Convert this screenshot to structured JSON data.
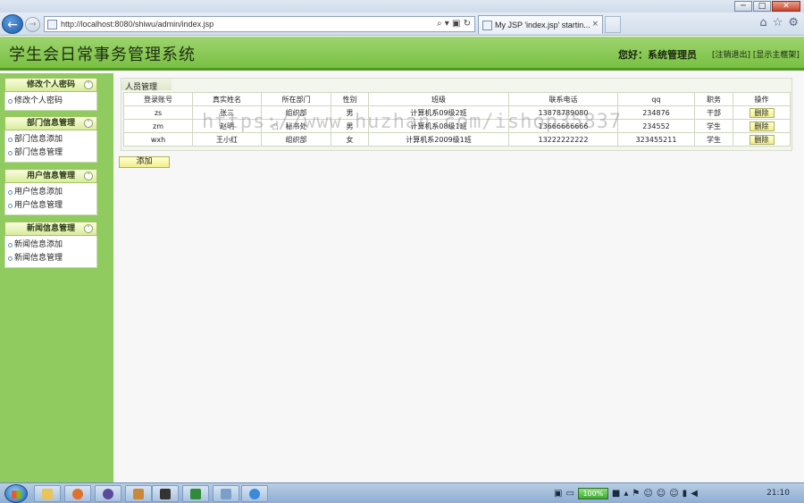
{
  "browser": {
    "window_buttons": {
      "minimize": "─",
      "maximize": "□",
      "close": "✕"
    },
    "address": "http://localhost:8080/shiwu/admin/index.jsp",
    "address_tools": "⌕ ▾ ▣ ↻",
    "tab_title": "My JSP 'index.jsp' startin...",
    "tab_close": "×",
    "nav_icons": [
      "home-icon",
      "star-icon",
      "gear-icon"
    ]
  },
  "header": {
    "title": "学生会日常事务管理系统",
    "greeting": "您好：系统管理员",
    "logout": "[注销退出]",
    "show_home": "[显示主框架]"
  },
  "sidebar": {
    "groups": [
      {
        "title": "修改个人密码",
        "items": [
          "修改个人密码"
        ]
      },
      {
        "title": "部门信息管理",
        "items": [
          "部门信息添加",
          "部门信息管理"
        ]
      },
      {
        "title": "用户信息管理",
        "items": [
          "用户信息添加",
          "用户信息管理"
        ]
      },
      {
        "title": "新闻信息管理",
        "items": [
          "新闻信息添加",
          "新闻信息管理"
        ]
      }
    ]
  },
  "main": {
    "panel_title": "人员管理",
    "columns": [
      "登录账号",
      "真实姓名",
      "所在部门",
      "性别",
      "班级",
      "联系电话",
      "qq",
      "职务",
      "操作"
    ],
    "rows": [
      [
        "zs",
        "张三",
        "组织部",
        "男",
        "计算机系09级2班",
        "13878789080",
        "234876",
        "干部"
      ],
      [
        "zm",
        "赵明",
        "秘书处",
        "男",
        "计算机系08级1班",
        "13666666666",
        "234552",
        "学生"
      ],
      [
        "wxh",
        "王小红",
        "组织部",
        "女",
        "计算机系2009级1班",
        "13222222222",
        "323455211",
        "学生"
      ]
    ],
    "delete_label": "删除",
    "add_label": "添加",
    "watermark": "https://www.huzhan.com/ishop35837"
  },
  "taskbar": {
    "battery": "100%",
    "clock": "21:10"
  }
}
